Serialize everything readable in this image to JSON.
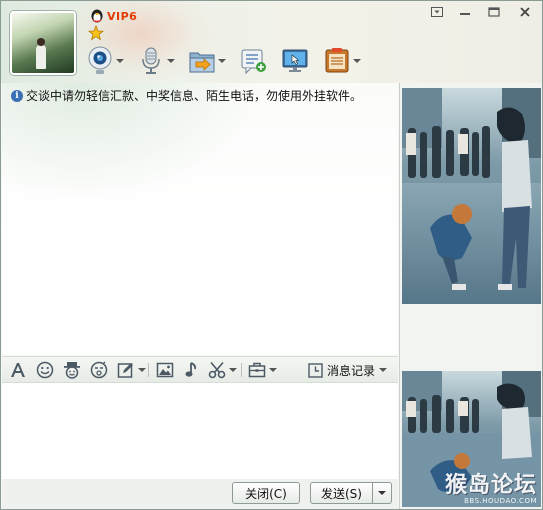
{
  "header": {
    "vip_label": "VIP6"
  },
  "chat": {
    "notice": "交谈中请勿轻信汇款、中奖信息、陌生电话，勿使用外挂软件。"
  },
  "format_bar": {
    "history_label": "消息记录"
  },
  "bottom": {
    "close_label": "关闭(C)",
    "send_label": "发送(S)"
  },
  "watermark": {
    "main": "猴岛论坛",
    "sub": "BBS.HOUDAO.COM"
  },
  "colors": {
    "vip": "#e03b00",
    "accent_blue": "#2f6fb8",
    "panel_border": "#8a9a94"
  },
  "icons": [
    "penguin-icon",
    "star-icon",
    "skin-icon",
    "minimize-icon",
    "maximize-icon",
    "close-icon",
    "webcam-icon",
    "microphone-icon",
    "file-transfer-icon",
    "group-chat-icon",
    "remote-desktop-icon",
    "app-box-icon",
    "font-icon",
    "emoticon-icon",
    "magic-face-icon",
    "animation-face-icon",
    "handwriting-icon",
    "image-icon",
    "music-icon",
    "screenshot-icon",
    "toolbox-icon",
    "history-icon",
    "info-icon"
  ]
}
